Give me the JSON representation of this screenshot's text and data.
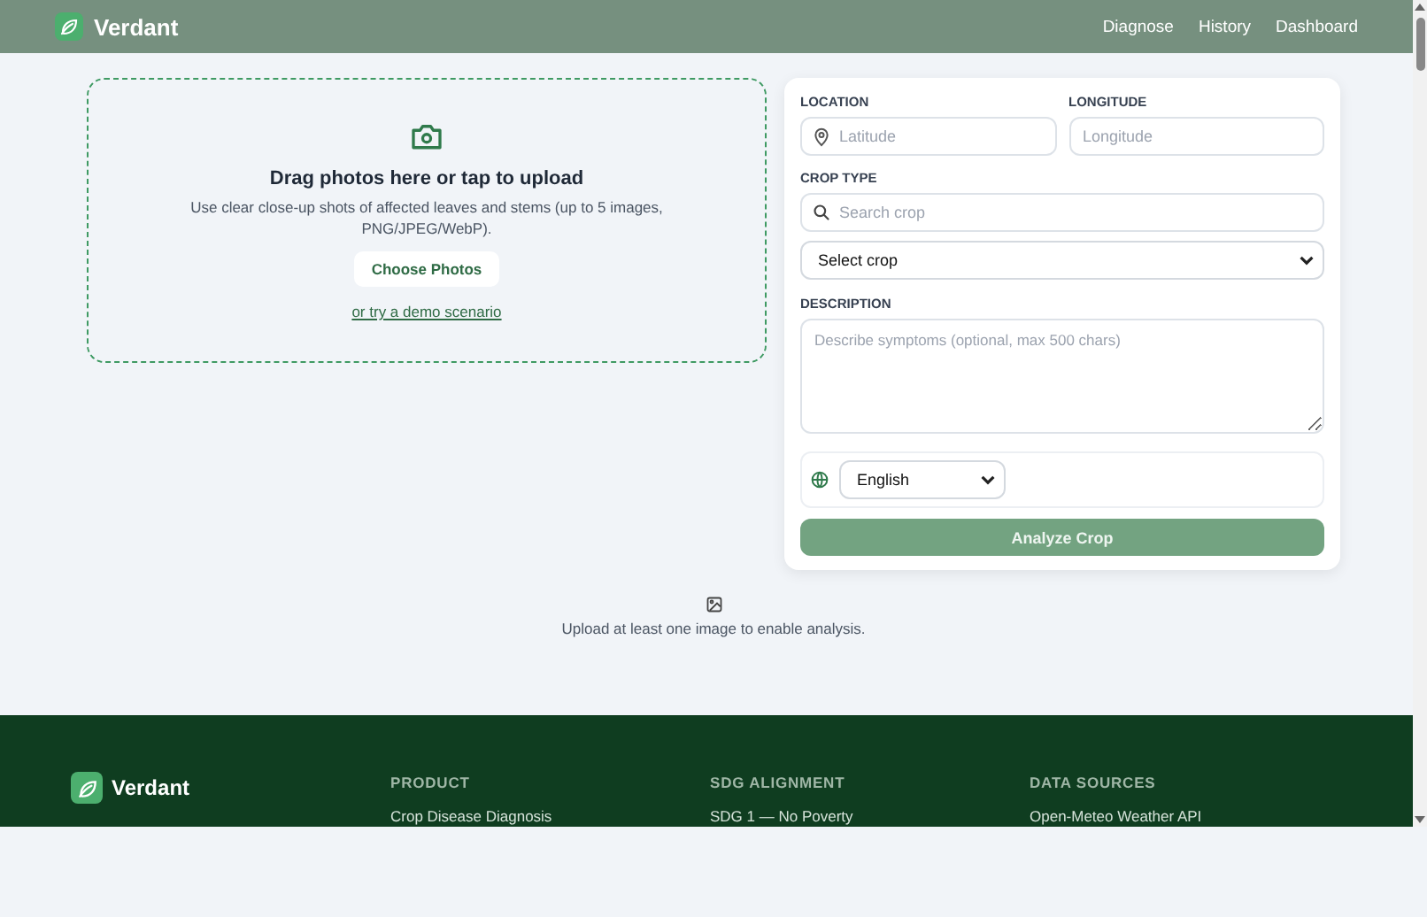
{
  "header": {
    "brand": "Verdant",
    "nav": [
      "Diagnose",
      "History",
      "Dashboard"
    ]
  },
  "upload": {
    "title": "Drag photos here or tap to upload",
    "hint": "Use clear close-up shots of affected leaves and stems (up to 5 images, PNG/JPEG/WebP).",
    "button": "Choose Photos",
    "demo_link": "or try a demo scenario"
  },
  "form": {
    "location_label": "LOCATION",
    "latitude_placeholder": "Latitude",
    "longitude_label": "LONGITUDE",
    "longitude_placeholder": "Longitude",
    "crop_label": "CROP TYPE",
    "crop_search_placeholder": "Search crop",
    "crop_select": "Select crop",
    "description_label": "DESCRIPTION",
    "description_placeholder": "Describe symptoms (optional, max 500 chars)",
    "language": "English",
    "submit": {
      "label": "Analyze Crop",
      "disabled": true
    }
  },
  "notice": "Upload at least one image to enable analysis.",
  "footer": {
    "brand": "Verdant",
    "columns": [
      {
        "heading": "PRODUCT",
        "items": [
          "Crop Disease Diagnosis"
        ]
      },
      {
        "heading": "SDG ALIGNMENT",
        "items": [
          "SDG 1 — No Poverty"
        ]
      },
      {
        "heading": "DATA SOURCES",
        "items": [
          "Open-Meteo Weather API"
        ]
      }
    ]
  }
}
